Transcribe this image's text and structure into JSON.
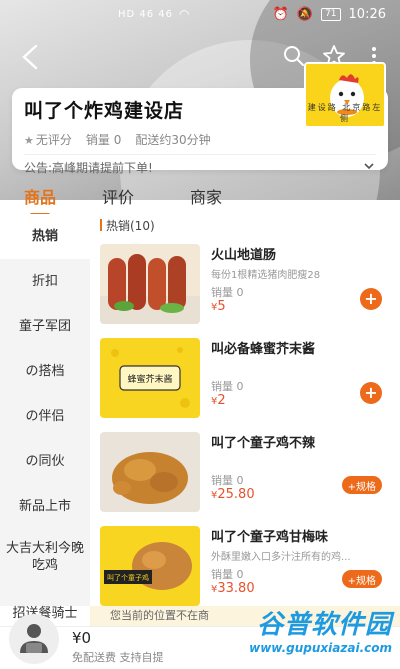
{
  "status_bar": {
    "signal_text": "HD 46 46",
    "battery": "71",
    "time": "10:26"
  },
  "store": {
    "name": "叫了个炸鸡建设店",
    "rating": "无评分",
    "sales": "销量 0",
    "delivery": "配送约30分钟",
    "notice": "公告:高峰期请提前下单!",
    "logo_caption": "建设路  北京路左侧"
  },
  "tabs": [
    {
      "label": "商品"
    },
    {
      "label": "评价"
    },
    {
      "label": "商家"
    }
  ],
  "categories": [
    {
      "label": "热销"
    },
    {
      "label": "折扣"
    },
    {
      "label": "童子军团"
    },
    {
      "label": "の搭档"
    },
    {
      "label": "の伴侣"
    },
    {
      "label": "の同伙"
    },
    {
      "label": "新品上市"
    },
    {
      "label": "大吉大利今晚吃鸡"
    },
    {
      "label": "招送餐骑士"
    }
  ],
  "section_title": "热销(10)",
  "products": [
    {
      "name": "火山地道肠",
      "desc": "每份1根精选猪肉肥瘦28",
      "sales": "销量 0",
      "currency": "¥",
      "price": "5",
      "action": "+"
    },
    {
      "name": "叫必备蜂蜜芥末酱",
      "desc": "",
      "sales": "销量 0",
      "currency": "¥",
      "price": "2",
      "action": "+"
    },
    {
      "name": "叫了个童子鸡不辣",
      "desc": "",
      "sales": "销量 0",
      "currency": "¥",
      "price": "25.80",
      "action": "+规格"
    },
    {
      "name": "叫了个童子鸡甘梅味",
      "desc": "外酥里嫩入口多汁注所有的鸡...",
      "sales": "销量 0",
      "currency": "¥",
      "price": "33.80",
      "action": "+规格"
    }
  ],
  "product_image_labels": {
    "sauce": "蜂蜜芥末酱",
    "chicken": "叫了个童子鸡"
  },
  "hint": "您当前的位置不在商",
  "cart": {
    "amount": "¥0",
    "note": "免配送费  支持自提"
  },
  "watermark": {
    "big": "谷普软件园",
    "small": "www.gupuxiazai.com"
  },
  "colors": {
    "accent": "#e2741b",
    "button": "#ec6a1a",
    "price": "#e5532d",
    "logo_yellow": "#f9d41a",
    "watermark": "#1e9be0"
  }
}
